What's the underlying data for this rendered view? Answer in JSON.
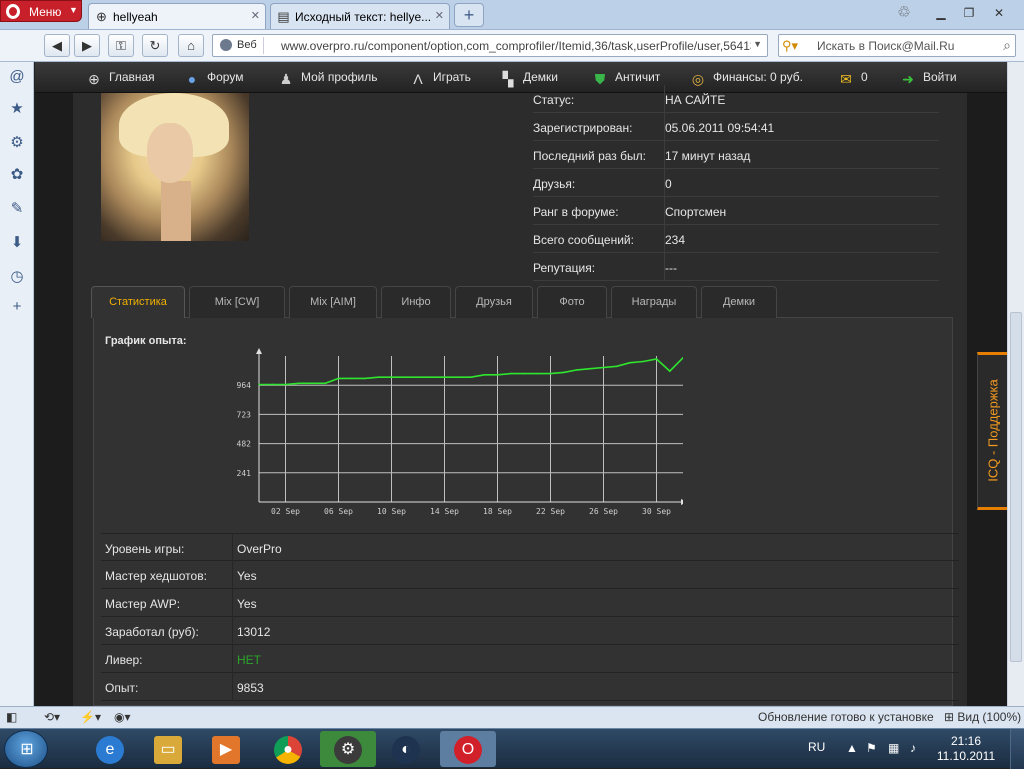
{
  "browser": {
    "menu_label": "Меню",
    "tabs": [
      {
        "title": "hellyeah",
        "active": true
      },
      {
        "title": "Исходный текст: hellye...",
        "active": false
      }
    ],
    "site_label": "Веб",
    "url": "www.overpro.ru/component/option,com_comprofiler/Itemid,36/task,userProfile/user,56413/",
    "search_placeholder": "Искать в Поиск@Mail.Ru"
  },
  "site_menu": [
    {
      "label": "Главная",
      "icon": "home-icon"
    },
    {
      "label": "Форум",
      "icon": "forum-icon"
    },
    {
      "label": "Мой профиль",
      "icon": "profile-icon"
    },
    {
      "label": "Играть",
      "icon": "play-icon"
    },
    {
      "label": "Демки",
      "icon": "demo-icon"
    },
    {
      "label": "Античит",
      "icon": "shield-icon"
    },
    {
      "label": "Финансы: 0 руб.",
      "icon": "coins-icon"
    },
    {
      "label": "0",
      "icon": "mail-icon"
    },
    {
      "label": "Войти",
      "icon": "login-icon"
    }
  ],
  "profile_info": [
    {
      "key": "Статус:",
      "value": "НА САЙТЕ"
    },
    {
      "key": "Зарегистрирован:",
      "value": "05.06.2011 09:54:41"
    },
    {
      "key": "Последний раз был:",
      "value": "17 минут назад"
    },
    {
      "key": "Друзья:",
      "value": "0"
    },
    {
      "key": "Ранг в форуме:",
      "value": "Спортсмен"
    },
    {
      "key": "Всего сообщений:",
      "value": "234"
    },
    {
      "key": "Репутация:",
      "value": "---"
    }
  ],
  "tabs": [
    "Статистика",
    "Mix [CW]",
    "Mix [AIM]",
    "Инфо",
    "Друзья",
    "Фото",
    "Награды",
    "Демки"
  ],
  "active_tab": "Статистика",
  "chart_title": "График опыта:",
  "chart_data": {
    "type": "line",
    "title": "График опыта:",
    "x": [
      "31 Aug",
      "01 Sep",
      "02 Sep",
      "03 Sep",
      "04 Sep",
      "05 Sep",
      "06 Sep",
      "07 Sep",
      "08 Sep",
      "09 Sep",
      "10 Sep",
      "11 Sep",
      "12 Sep",
      "13 Sep",
      "14 Sep",
      "15 Sep",
      "16 Sep",
      "17 Sep",
      "18 Sep",
      "19 Sep",
      "20 Sep",
      "21 Sep",
      "22 Sep",
      "23 Sep",
      "24 Sep",
      "25 Sep",
      "26 Sep",
      "27 Sep",
      "28 Sep",
      "29 Sep",
      "30 Sep",
      "01 Oct",
      "02 Oct"
    ],
    "values": [
      970,
      970,
      970,
      980,
      980,
      980,
      1020,
      1020,
      1020,
      1030,
      1030,
      1030,
      1030,
      1030,
      1030,
      1030,
      1030,
      1050,
      1050,
      1060,
      1060,
      1060,
      1060,
      1070,
      1090,
      1100,
      1110,
      1120,
      1150,
      1160,
      1180,
      1080,
      1190
    ],
    "x_tick_labels": [
      "02 Sep",
      "06 Sep",
      "10 Sep",
      "14 Sep",
      "18 Sep",
      "22 Sep",
      "26 Sep",
      "30 Sep"
    ],
    "y_tick_labels": [
      "964",
      "723",
      "482",
      "241"
    ],
    "y_ticks": [
      964,
      723,
      482,
      241
    ],
    "ylim": [
      0,
      1205
    ],
    "line_color": "#2ee62e",
    "grid": true
  },
  "stats": [
    {
      "key": "Уровень игры:",
      "value": "OverPro",
      "color": "#e6e6e6"
    },
    {
      "key": "Мастер хедшотов:",
      "value": "Yes",
      "color": "#e6e6e6"
    },
    {
      "key": "Мастер AWP:",
      "value": "Yes",
      "color": "#e6e6e6"
    },
    {
      "key": "Заработал (руб):",
      "value": "13012",
      "color": "#e6e6e6"
    },
    {
      "key": "Ливер:",
      "value": "НЕТ",
      "color": "#2aa52a"
    },
    {
      "key": "Опыт:",
      "value": "9853",
      "color": "#e6e6e6"
    }
  ],
  "side_widget": "ICQ - Поддержка",
  "statusbar": {
    "update_text": "Обновление готово к установке",
    "zoom_text": "Вид (100%)"
  },
  "taskbar": {
    "lang": "RU",
    "time": "21:16",
    "date": "11.10.2011"
  }
}
